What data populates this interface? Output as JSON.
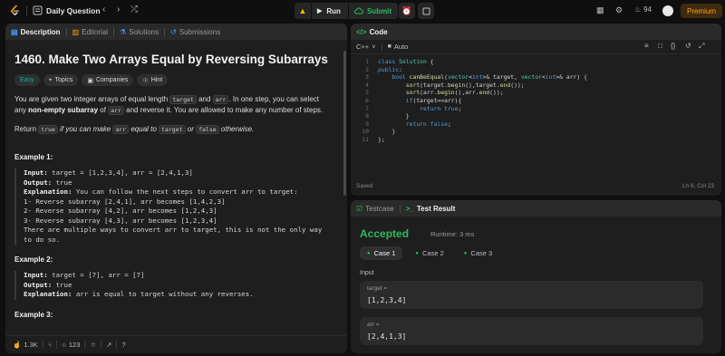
{
  "topbar": {
    "title": "Daily Question",
    "run_label": "Run",
    "submit_label": "Submit",
    "streak_count": "94",
    "premium_label": "Premium"
  },
  "description": {
    "tabs": [
      {
        "label": "Description"
      },
      {
        "label": "Editorial"
      },
      {
        "label": "Solutions"
      },
      {
        "label": "Submissions"
      }
    ],
    "title": "1460. Make Two Arrays Equal by Reversing Subarrays",
    "difficulty": "Easy",
    "chips": [
      "Topics",
      "Companies",
      "Hint"
    ],
    "para1": {
      "a": "You are given two integer arrays of equal length ",
      "c1": "target",
      "b": " and ",
      "c2": "arr",
      "c": ". In one step, you can select any ",
      "d": "non-empty subarray",
      "e": " of ",
      "c3": "arr",
      "f": " and reverse it. You are allowed to make any number of steps."
    },
    "para2": {
      "a": "Return ",
      "c1": "true",
      "b": " if you can make ",
      "c2": "arr",
      "c": " equal to ",
      "c3": "target",
      "d": " or ",
      "c4": "false",
      "e": " otherwise."
    },
    "example1": {
      "title": "Example 1:",
      "input_label": "Input:",
      "input": " target = [1,2,3,4], arr = [2,4,1,3]",
      "output_label": "Output:",
      "output": " true",
      "explanation_label": "Explanation:",
      "explanation": " You can follow the next steps to convert arr to target:",
      "lines": [
        "1- Reverse subarray [2,4,1], arr becomes [1,4,2,3]",
        "2- Reverse subarray [4,2], arr becomes [1,2,4,3]",
        "3- Reverse subarray [4,3], arr becomes [1,2,3,4]",
        "There are multiple ways to convert arr to target, this is not the only way",
        "to do so."
      ]
    },
    "example2": {
      "title": "Example 2:",
      "input_label": "Input:",
      "input": " target = [7], arr = [7]",
      "output_label": "Output:",
      "output": " true",
      "explanation_label": "Explanation:",
      "explanation": " arr is equal to target without any reverses."
    },
    "example3": {
      "title": "Example 3:"
    },
    "footer": {
      "likes": "1.3K",
      "comments": "123"
    }
  },
  "code": {
    "tab_label": "Code",
    "language": "C++",
    "mode": "Auto",
    "lines": [
      {
        "n": "1",
        "parts": [
          [
            "kw",
            "class "
          ],
          [
            "ty",
            "Solution "
          ],
          [
            "tx",
            "{"
          ]
        ]
      },
      {
        "n": "2",
        "parts": [
          [
            "kw",
            "public"
          ],
          [
            "tx",
            ":"
          ]
        ]
      },
      {
        "n": "3",
        "parts": [
          [
            "tx",
            "    "
          ],
          [
            "kw",
            "bool "
          ],
          [
            "fn",
            "canBeEqual"
          ],
          [
            "tx",
            "("
          ],
          [
            "ty",
            "vector"
          ],
          [
            "tx",
            "<"
          ],
          [
            "kw",
            "int"
          ],
          [
            "tx",
            ">& target, "
          ],
          [
            "ty",
            "vector"
          ],
          [
            "tx",
            "<"
          ],
          [
            "kw",
            "int"
          ],
          [
            "tx",
            ">& arr) {"
          ]
        ]
      },
      {
        "n": "4",
        "parts": [
          [
            "tx",
            "        "
          ],
          [
            "fn",
            "sort"
          ],
          [
            "tx",
            "(target."
          ],
          [
            "fn",
            "begin"
          ],
          [
            "tx",
            "(),target."
          ],
          [
            "fn",
            "end"
          ],
          [
            "tx",
            "());"
          ]
        ]
      },
      {
        "n": "5",
        "parts": [
          [
            "tx",
            "        "
          ],
          [
            "fn",
            "sort"
          ],
          [
            "tx",
            "(arr."
          ],
          [
            "fn",
            "begin"
          ],
          [
            "tx",
            "(),arr."
          ],
          [
            "fn",
            "end"
          ],
          [
            "tx",
            "());"
          ]
        ]
      },
      {
        "n": "6",
        "parts": [
          [
            "tx",
            "        "
          ],
          [
            "kw",
            "if"
          ],
          [
            "tx",
            "(target==arr){"
          ]
        ]
      },
      {
        "n": "7",
        "parts": [
          [
            "tx",
            "            "
          ],
          [
            "kw",
            "return "
          ],
          [
            "kw",
            "true"
          ],
          [
            "tx",
            ";"
          ]
        ]
      },
      {
        "n": "8",
        "parts": [
          [
            "tx",
            "        }"
          ]
        ]
      },
      {
        "n": "9",
        "parts": [
          [
            "tx",
            "        "
          ],
          [
            "kw",
            "return "
          ],
          [
            "kw",
            "false"
          ],
          [
            "tx",
            ";"
          ]
        ]
      },
      {
        "n": "10",
        "parts": [
          [
            "tx",
            "    }"
          ]
        ]
      },
      {
        "n": "11",
        "parts": [
          [
            "tx",
            "};"
          ]
        ]
      }
    ],
    "status": "Saved",
    "cursor": "Ln 6, Col 23"
  },
  "test": {
    "tabs": [
      {
        "label": "Testcase"
      },
      {
        "label": "Test Result"
      }
    ],
    "verdict": "Accepted",
    "runtime": "Runtime: 3 ms",
    "cases": [
      "Case 1",
      "Case 2",
      "Case 3"
    ],
    "input_label": "Input",
    "inputs": [
      {
        "name": "target =",
        "value": "[1,2,3,4]"
      },
      {
        "name": "arr =",
        "value": "[2,4,1,3]"
      }
    ]
  },
  "colors": {
    "accent_green": "#2cbb5d",
    "premium": "#ffa116",
    "easy": "#00b8a3"
  }
}
